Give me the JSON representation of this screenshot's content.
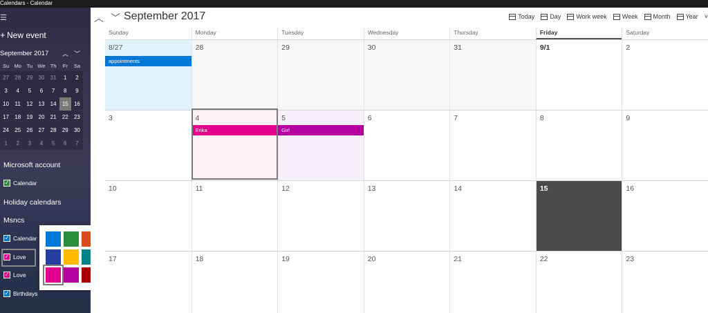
{
  "window": {
    "title": "Calendars - Calendar"
  },
  "sidebar": {
    "new_event_label": "New event",
    "mini_calendar": {
      "month_label": "September 2017",
      "day_headers": [
        "Su",
        "Mo",
        "Tu",
        "We",
        "Th",
        "Fr",
        "Sa"
      ],
      "weeks": [
        [
          "27",
          "28",
          "29",
          "30",
          "31",
          "1",
          "2"
        ],
        [
          "3",
          "4",
          "5",
          "6",
          "7",
          "8",
          "9"
        ],
        [
          "10",
          "11",
          "12",
          "13",
          "14",
          "15",
          "16"
        ],
        [
          "17",
          "18",
          "19",
          "20",
          "21",
          "22",
          "23"
        ],
        [
          "24",
          "25",
          "26",
          "27",
          "28",
          "29",
          "30"
        ],
        [
          "1",
          "2",
          "3",
          "4",
          "5",
          "6",
          "7"
        ]
      ],
      "today": "15"
    },
    "sections": {
      "microsoft_account": "Microsoft account",
      "microsoft_calendar": "Calendar",
      "holiday_calendars": "Holiday calendars",
      "msncs": "Msncs",
      "msncs_items": [
        "Calendar",
        "Love",
        "Love",
        "Birthdays"
      ]
    }
  },
  "color_picker": {
    "colors": [
      "#0078d7",
      "#2d8c3c",
      "#d84a1b",
      "#263ea0",
      "#ffb900",
      "#038387",
      "#e3008c",
      "#b4009e",
      "#a80000"
    ],
    "selected_index": 6
  },
  "toolbar": {
    "month_title": "September 2017",
    "views": {
      "today": "Today",
      "day": "Day",
      "work_week": "Work week",
      "week": "Week",
      "month": "Month",
      "year": "Year"
    }
  },
  "calendar": {
    "weekdays": [
      "Sunday",
      "Monday",
      "Tuesday",
      "Wednesday",
      "Thursday",
      "Friday",
      "Saturday"
    ],
    "current_weekday": "Friday",
    "weeks": [
      [
        "8/27",
        "28",
        "29",
        "30",
        "31",
        "9/1",
        "2"
      ],
      [
        "3",
        "4",
        "5",
        "6",
        "7",
        "8",
        "9"
      ],
      [
        "10",
        "11",
        "12",
        "13",
        "14",
        "15",
        "16"
      ],
      [
        "17",
        "18",
        "19",
        "20",
        "21",
        "22",
        "23"
      ]
    ],
    "events": {
      "appointments": "appointments",
      "erika": "Erika",
      "girl": "Girl"
    },
    "colors": {
      "appointments": "#0078d7",
      "erika": "#e3008c",
      "girl": "#b4009e"
    }
  }
}
